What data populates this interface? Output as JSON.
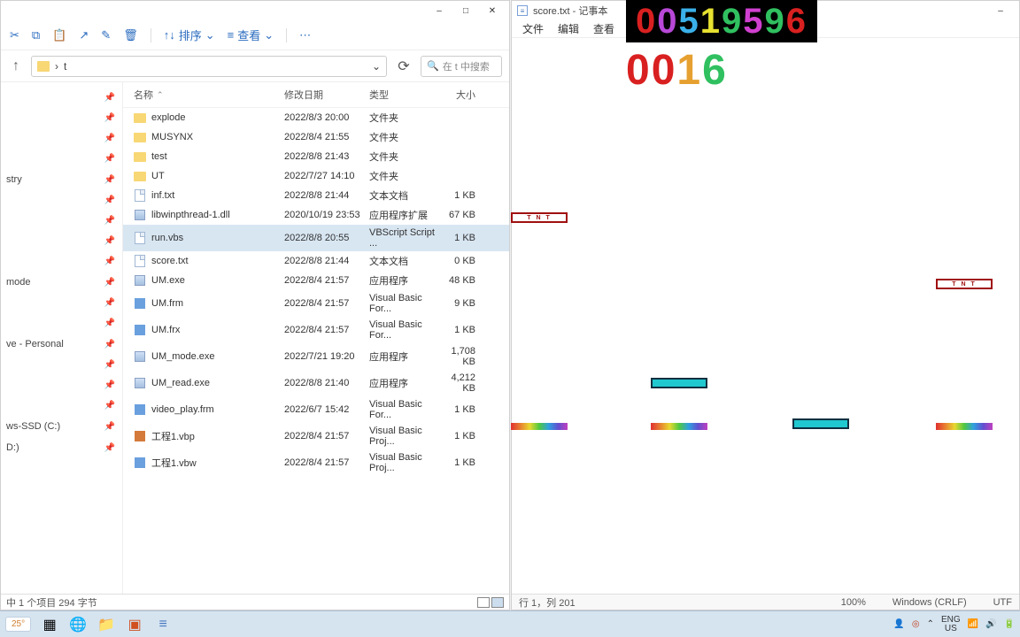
{
  "explorer": {
    "window_controls": {
      "min": "–",
      "max": "□",
      "close": "✕"
    },
    "toolbar": {
      "cut": "✂",
      "copy": "⧉",
      "paste": "📋",
      "share": "↗",
      "rename": "✎",
      "delete": "🗑",
      "sort_label": "排序",
      "view_label": "查看",
      "more": "⋯"
    },
    "nav": {
      "up": "↑",
      "dropdown": "⌄",
      "refresh": "⟳"
    },
    "path": "t",
    "search_placeholder": "在 t 中搜索",
    "columns": {
      "name": "名称",
      "date": "修改日期",
      "type": "类型",
      "size": "大小"
    },
    "files": [
      {
        "icon": "folder",
        "name": "explode",
        "date": "2022/8/3 20:00",
        "type": "文件夹",
        "size": ""
      },
      {
        "icon": "folder",
        "name": "MUSYNX",
        "date": "2022/8/4 21:55",
        "type": "文件夹",
        "size": ""
      },
      {
        "icon": "folder",
        "name": "test",
        "date": "2022/8/8 21:43",
        "type": "文件夹",
        "size": ""
      },
      {
        "icon": "folder",
        "name": "UT",
        "date": "2022/7/27 14:10",
        "type": "文件夹",
        "size": ""
      },
      {
        "icon": "doc",
        "name": "inf.txt",
        "date": "2022/8/8 21:44",
        "type": "文本文档",
        "size": "1 KB"
      },
      {
        "icon": "exe",
        "name": "libwinpthread-1.dll",
        "date": "2020/10/19 23:53",
        "type": "应用程序扩展",
        "size": "67 KB"
      },
      {
        "icon": "doc",
        "name": "run.vbs",
        "date": "2022/8/8 20:55",
        "type": "VBScript Script ...",
        "size": "1 KB",
        "selected": true
      },
      {
        "icon": "doc",
        "name": "score.txt",
        "date": "2022/8/8 21:44",
        "type": "文本文档",
        "size": "0 KB"
      },
      {
        "icon": "exe",
        "name": "UM.exe",
        "date": "2022/8/4 21:57",
        "type": "应用程序",
        "size": "48 KB"
      },
      {
        "icon": "vb",
        "name": "UM.frm",
        "date": "2022/8/4 21:57",
        "type": "Visual Basic For...",
        "size": "9 KB"
      },
      {
        "icon": "vb",
        "name": "UM.frx",
        "date": "2022/8/4 21:57",
        "type": "Visual Basic For...",
        "size": "1 KB"
      },
      {
        "icon": "exe",
        "name": "UM_mode.exe",
        "date": "2022/7/21 19:20",
        "type": "应用程序",
        "size": "1,708 KB"
      },
      {
        "icon": "exe",
        "name": "UM_read.exe",
        "date": "2022/8/8 21:40",
        "type": "应用程序",
        "size": "4,212 KB"
      },
      {
        "icon": "vb",
        "name": "video_play.frm",
        "date": "2022/6/7 15:42",
        "type": "Visual Basic For...",
        "size": "1 KB"
      },
      {
        "icon": "vbp",
        "name": "工程1.vbp",
        "date": "2022/8/4 21:57",
        "type": "Visual Basic Proj...",
        "size": "1 KB"
      },
      {
        "icon": "vb",
        "name": "工程1.vbw",
        "date": "2022/8/4 21:57",
        "type": "Visual Basic Proj...",
        "size": "1 KB"
      }
    ],
    "sidebar": [
      "",
      "",
      "",
      "",
      "stry",
      "",
      "",
      "",
      "",
      "mode",
      "",
      "",
      "ve - Personal",
      "",
      "",
      "",
      "ws-SSD (C:)",
      "D:)"
    ],
    "status": "中 1 个项目   294 字节"
  },
  "notepad": {
    "title": "score.txt - 记事本",
    "window_controls": {
      "min": "–"
    },
    "menu": [
      "文件",
      "编辑",
      "查看"
    ],
    "status": {
      "pos": "行 1，列 201",
      "zoom": "100%",
      "encoding": "Windows (CRLF)",
      "utf": "UTF"
    }
  },
  "game": {
    "score": [
      "0",
      "0",
      "5",
      "1",
      "9",
      "5",
      "9",
      "6"
    ],
    "counter": [
      "0",
      "0",
      "1",
      "6"
    ],
    "tnt_label": "T N T"
  },
  "taskbar": {
    "weather": "25°",
    "lang1": "ENG",
    "lang2": "US"
  }
}
